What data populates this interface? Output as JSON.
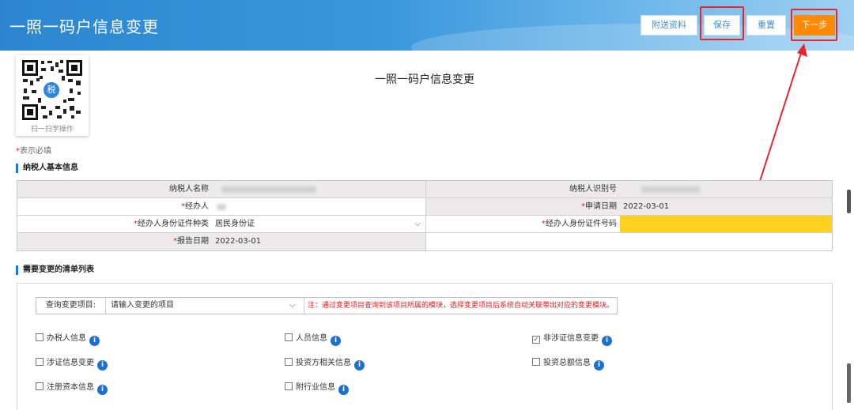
{
  "header": {
    "title": "一照一码户信息变更",
    "buttons": {
      "attach": "附送资料",
      "save": "保存",
      "reset": "重置",
      "next": "下一步"
    }
  },
  "qr": {
    "label": "扫一扫学操作",
    "badge": "税"
  },
  "document": {
    "title": "一照一码户信息变更",
    "required_star": "*",
    "required_note": "表示必填"
  },
  "basic_info": {
    "section_title": "纳税人基本信息",
    "taxpayer_name_label": "纳税人名称",
    "taxpayer_id_label": "纳税人识别号",
    "agent_label": "经办人",
    "apply_date_label": "申请日期",
    "apply_date_value": "2022-03-01",
    "id_type_label": "经办人身份证件种类",
    "id_type_value": "居民身份证",
    "id_number_label": "经办人身份证件号码",
    "report_date_label": "报告日期",
    "report_date_value": "2022-03-01",
    "star": "*"
  },
  "change_list": {
    "section_title": "需要变更的清单列表",
    "query_label": "查询变更项目:",
    "query_placeholder": "请输入变更的项目",
    "query_note": "注：通过变更项目查询到该项目所属的模块，选择变更项目后系统自动关联带出对应的变更模块。",
    "items": [
      {
        "label": "办税人信息",
        "checked": false
      },
      {
        "label": "人员信息",
        "checked": false
      },
      {
        "label": "非涉证信息变更",
        "checked": true
      },
      {
        "label": "涉证信息变更",
        "checked": false
      },
      {
        "label": "投资方相关信息",
        "checked": false
      },
      {
        "label": "投资总额信息",
        "checked": false
      },
      {
        "label": "注册资本信息",
        "checked": false
      },
      {
        "label": "附行业信息",
        "checked": false
      }
    ],
    "check_mark": "✓",
    "info_glyph": "i"
  },
  "colors": {
    "header_blue": "#2b86cf",
    "next_orange": "#ff8a00",
    "highlight_red": "#e8262b",
    "input_yellow": "#ffd21f"
  }
}
